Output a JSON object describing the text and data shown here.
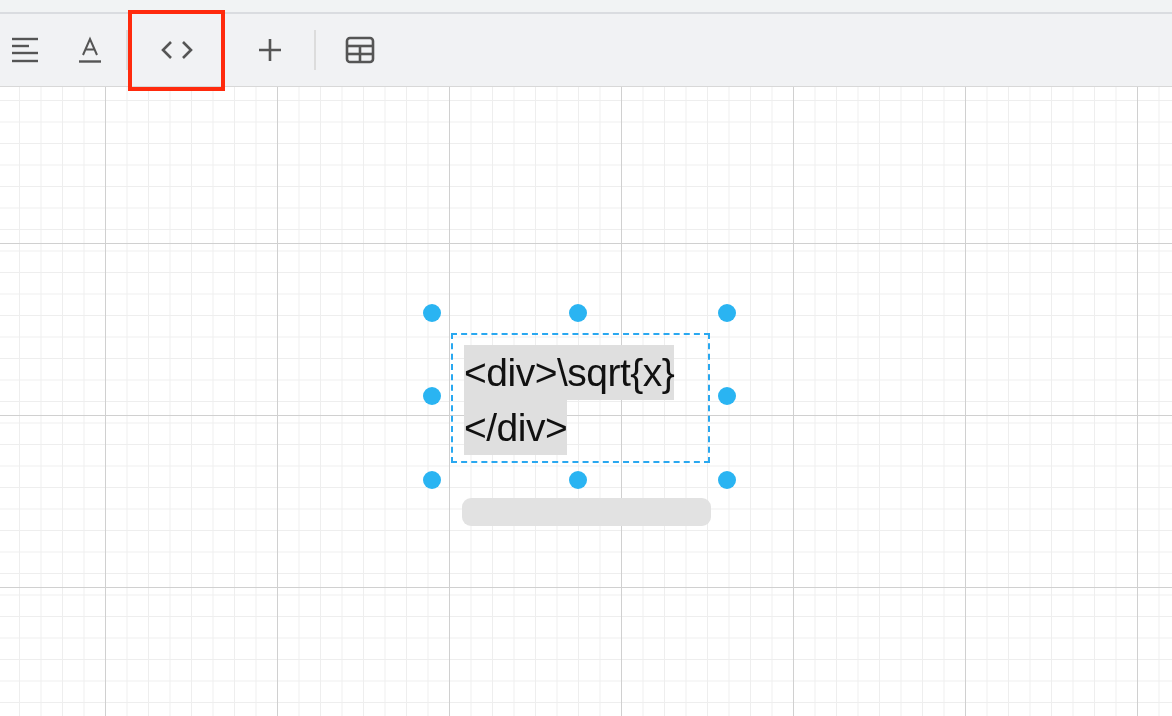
{
  "toolbar": [
    {
      "kind": "align-left",
      "highlighted": false
    },
    {
      "kind": "text-format",
      "highlighted": false
    },
    {
      "kind": "separator"
    },
    {
      "kind": "code",
      "highlighted": true
    },
    {
      "kind": "plus",
      "highlighted": false
    },
    {
      "kind": "separator"
    },
    {
      "kind": "table",
      "highlighted": false
    }
  ],
  "shape": {
    "lines": [
      "<div>\\sqrt{x}",
      "</div>"
    ],
    "selected": true
  }
}
